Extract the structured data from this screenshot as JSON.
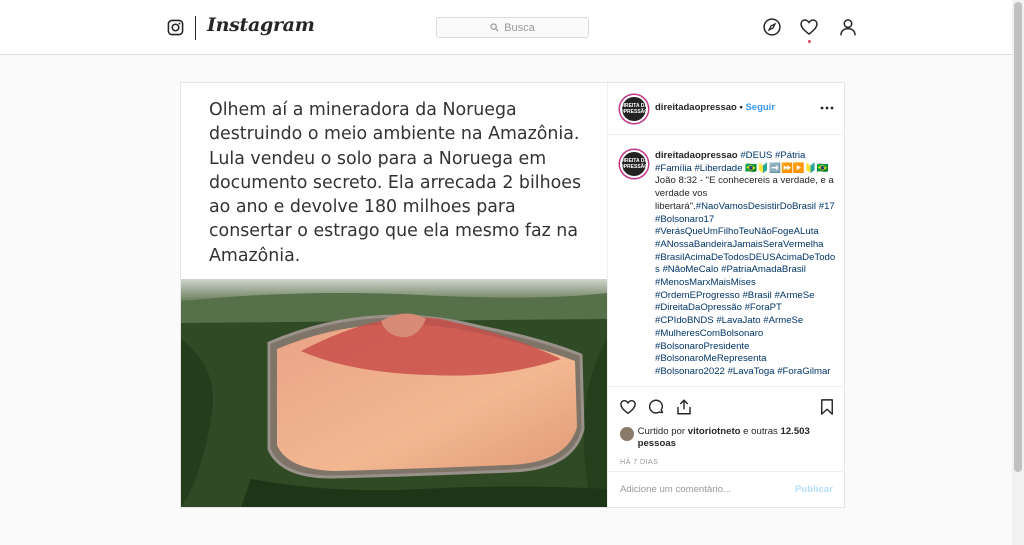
{
  "header": {
    "wordmark": "Instagram",
    "search_placeholder": "Busca",
    "icons": [
      "instagram-camera-icon",
      "compass-icon",
      "heart-icon",
      "profile-icon"
    ]
  },
  "post": {
    "image_text": "Olhem aí a mineradora da Noruega destruindo o meio ambiente na Amazônia. Lula vendeu o solo para a Noruega em documento secreto.\nEla arrecada 2 bilhoes ao ano e devolve 180 milhoes para consertar o estrago que ela mesmo faz na Amazônia.",
    "author": "direitadaopressao",
    "separator": " • ",
    "follow_label": "Seguir",
    "avatar_text": "DIREITA DA OPRESSÃO",
    "caption_user": "direitadaopressao",
    "caption_parts": [
      {
        "t": "tag",
        "v": "#DEUS"
      },
      {
        "t": "txt",
        "v": " "
      },
      {
        "t": "tag",
        "v": "#Pátria"
      },
      {
        "t": "txt",
        "v": " "
      },
      {
        "t": "tag",
        "v": "#Família"
      },
      {
        "t": "txt",
        "v": " "
      },
      {
        "t": "tag",
        "v": "#Liberdade"
      },
      {
        "t": "txt",
        "v": " 🇧🇷🔰➡️⏩▶️🔰🇧🇷João 8:32 - \"E conhecereis a verdade, e a verdade vos libertará\"."
      },
      {
        "t": "tag",
        "v": "#NaoVamosDesistirDoBrasil"
      },
      {
        "t": "txt",
        "v": " "
      },
      {
        "t": "tag",
        "v": "#17"
      },
      {
        "t": "txt",
        "v": " "
      },
      {
        "t": "tag",
        "v": "#Bolsonaro17"
      },
      {
        "t": "txt",
        "v": " "
      },
      {
        "t": "tag",
        "v": "#VerásQueUmFilhoTeuNãoFogeALuta"
      },
      {
        "t": "txt",
        "v": " "
      },
      {
        "t": "tag",
        "v": "#ANossaBandeiraJamaisSeraVermelha"
      },
      {
        "t": "txt",
        "v": " "
      },
      {
        "t": "tag",
        "v": "#BrasilAcimaDeTodosDEUSAcimaDeTodos"
      },
      {
        "t": "txt",
        "v": " "
      },
      {
        "t": "tag",
        "v": "#NãoMeCalo"
      },
      {
        "t": "txt",
        "v": " "
      },
      {
        "t": "tag",
        "v": "#PatriaAmadaBrasil"
      },
      {
        "t": "txt",
        "v": " "
      },
      {
        "t": "tag",
        "v": "#MenosMarxMaisMises"
      },
      {
        "t": "txt",
        "v": " "
      },
      {
        "t": "tag",
        "v": "#OrdemEProgresso"
      },
      {
        "t": "txt",
        "v": " "
      },
      {
        "t": "tag",
        "v": "#Brasil"
      },
      {
        "t": "txt",
        "v": " "
      },
      {
        "t": "tag",
        "v": "#ArmeSe"
      },
      {
        "t": "txt",
        "v": " "
      },
      {
        "t": "tag",
        "v": "#DireitaDaOpressão"
      },
      {
        "t": "txt",
        "v": " "
      },
      {
        "t": "tag",
        "v": "#ForaPT"
      },
      {
        "t": "txt",
        "v": " "
      },
      {
        "t": "tag",
        "v": "#CPIdoBNDS"
      },
      {
        "t": "txt",
        "v": " "
      },
      {
        "t": "tag",
        "v": "#LavaJato"
      },
      {
        "t": "txt",
        "v": " "
      },
      {
        "t": "tag",
        "v": "#ArmeSe"
      },
      {
        "t": "txt",
        "v": " "
      },
      {
        "t": "tag",
        "v": "#MulheresComBolsonaro"
      },
      {
        "t": "txt",
        "v": " "
      },
      {
        "t": "tag",
        "v": "#BolsonaroPresidente"
      },
      {
        "t": "txt",
        "v": " "
      },
      {
        "t": "tag",
        "v": "#BolsonaroMeRepresenta"
      },
      {
        "t": "txt",
        "v": " "
      },
      {
        "t": "tag",
        "v": "#Bolsonaro2022"
      },
      {
        "t": "txt",
        "v": " "
      },
      {
        "t": "tag",
        "v": "#LavaToga"
      },
      {
        "t": "txt",
        "v": " "
      },
      {
        "t": "tag",
        "v": "#ForaGilmar"
      }
    ],
    "liked_prefix": "Curtido por ",
    "liked_user": "vitoriotneto",
    "liked_middle": " e outras ",
    "liked_count": "12.503 pessoas",
    "time_ago": "HÁ 7 DIAS",
    "comment_placeholder": "Adicione um comentário...",
    "publish_label": "Publicar"
  },
  "colors": {
    "accent_link": "#3897f0",
    "hashtag": "#003569",
    "border": "#dbdbdb",
    "background": "#fafafa"
  }
}
